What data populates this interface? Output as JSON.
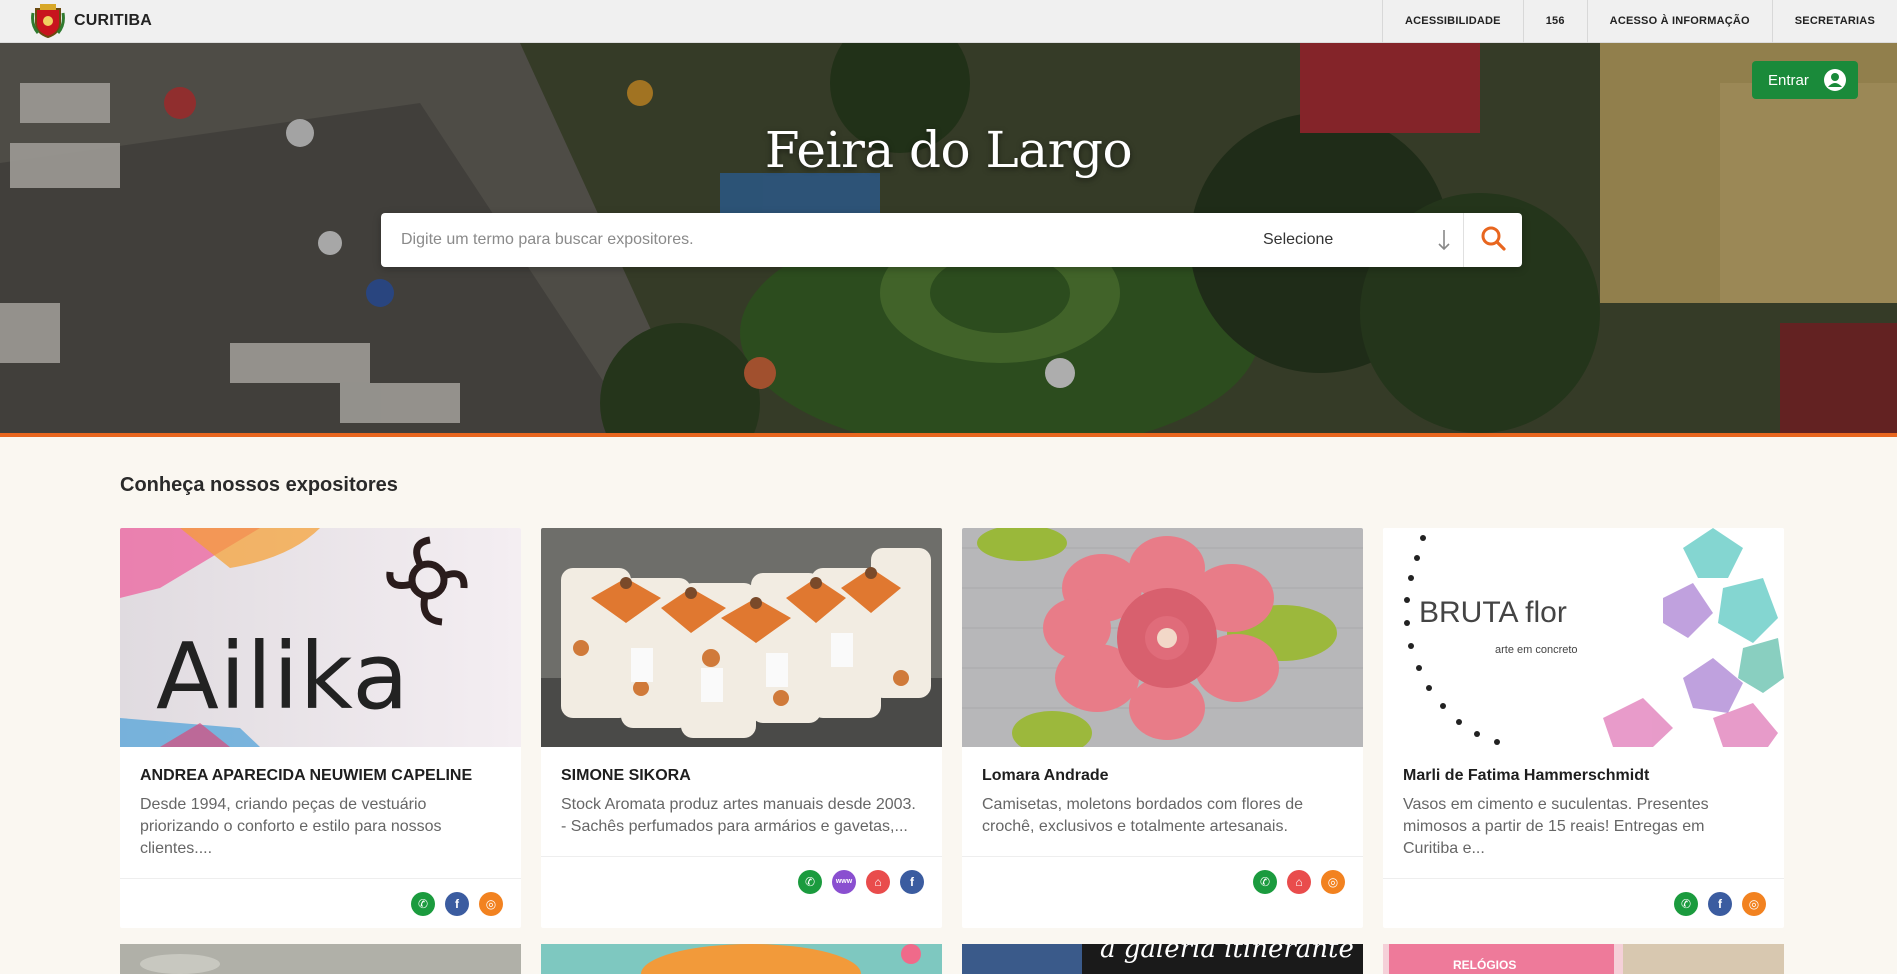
{
  "topbar": {
    "brand": "CURITIBA",
    "nav": [
      "ACESSIBILIDADE",
      "156",
      "ACESSO À INFORMAÇÃO",
      "SECRETARIAS"
    ]
  },
  "hero": {
    "title": "Feira do Largo",
    "login_label": "Entrar",
    "search_placeholder": "Digite um termo para buscar expositores.",
    "select_label": "Selecione"
  },
  "section": {
    "title": "Conheça nossos expositores"
  },
  "cards": [
    {
      "image_text": "Ailika",
      "name": "ANDREA APARECIDA NEUWIEM CAPELINE",
      "desc": "Desde 1994, criando peças de vestuário priorizando o conforto e estilo para nossos clientes....",
      "socials": [
        "whatsapp-icon",
        "facebook-icon",
        "instagram-icon"
      ]
    },
    {
      "image_text": "",
      "name": "SIMONE SIKORA",
      "desc": "Stock Aromata produz artes manuais desde 2003. - Sachês perfumados para armários e gavetas,...",
      "socials": [
        "whatsapp-icon",
        "website-icon",
        "shop-icon",
        "facebook-icon"
      ]
    },
    {
      "image_text": "",
      "name": "Lomara Andrade",
      "desc": "Camisetas, moletons bordados com flores de crochê, exclusivos e totalmente artesanais.",
      "socials": [
        "whatsapp-icon",
        "shop-icon",
        "instagram-icon"
      ]
    },
    {
      "image_text": "BRUTA flor",
      "image_subtext": "arte em concreto",
      "name": "Marli de Fatima Hammerschmidt",
      "desc": "Vasos em cimento e suculentas. Presentes mimosos a partir de 15 reais! Entregas em Curitiba e...",
      "socials": [
        "whatsapp-icon",
        "facebook-icon",
        "instagram-icon"
      ]
    }
  ],
  "row2": {
    "text3": "a galeria itinerante",
    "text4": "RELÓGIOS"
  },
  "colors": {
    "accent": "#e8661f",
    "login": "#1a8a3a",
    "background": "#faf7f1"
  }
}
